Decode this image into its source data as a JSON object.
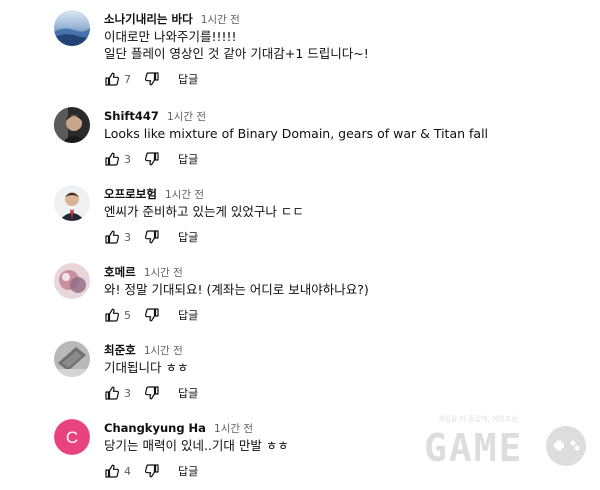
{
  "comments": [
    {
      "author": "소나기내리는 바다",
      "time": "1시간 전",
      "lines": [
        "이대로만 나와주기를!!!!!",
        "일단 플레이 영상인 것 같아 기대감+1 드립니다~!"
      ],
      "likes": "7",
      "reply_label": "답글",
      "avatar_icon": "ocean-photo-avatar"
    },
    {
      "author": "Shift447",
      "time": "1시간 전",
      "lines": [
        "Looks like mixture of Binary Domain, gears of war & Titan fall"
      ],
      "likes": "3",
      "reply_label": "답글",
      "avatar_icon": "person-photo-avatar"
    },
    {
      "author": "오프로보험",
      "time": "1시간 전",
      "lines": [
        "엔씨가 준비하고 있는게 있었구나 ㄷㄷ"
      ],
      "likes": "3",
      "reply_label": "답글",
      "avatar_icon": "suit-man-avatar"
    },
    {
      "author": "호메르",
      "time": "1시간 전",
      "lines": [
        "와! 정말 기대되요! (계좌는 어디로 보내야하나요?)"
      ],
      "likes": "5",
      "reply_label": "답글",
      "avatar_icon": "pink-photo-avatar"
    },
    {
      "author": "최준호",
      "time": "1시간 전",
      "lines": [
        "기대됩니다 ㅎㅎ"
      ],
      "likes": "3",
      "reply_label": "답글",
      "avatar_icon": "object-photo-avatar"
    },
    {
      "author": "Changkyung Ha",
      "time": "1시간 전",
      "lines": [
        "당기는 매력이 있네..기대 만발 ㅎㅎ"
      ],
      "likes": "4",
      "reply_label": "답글",
      "avatar_letter": "C",
      "avatar_color": "#e8437f"
    }
  ],
  "colors": {
    "text": "#0f0f0f",
    "secondary": "#606060"
  },
  "watermark": {
    "small_text": "게임을 더 즐겁게, 게임조선",
    "big_text": "GAME"
  }
}
